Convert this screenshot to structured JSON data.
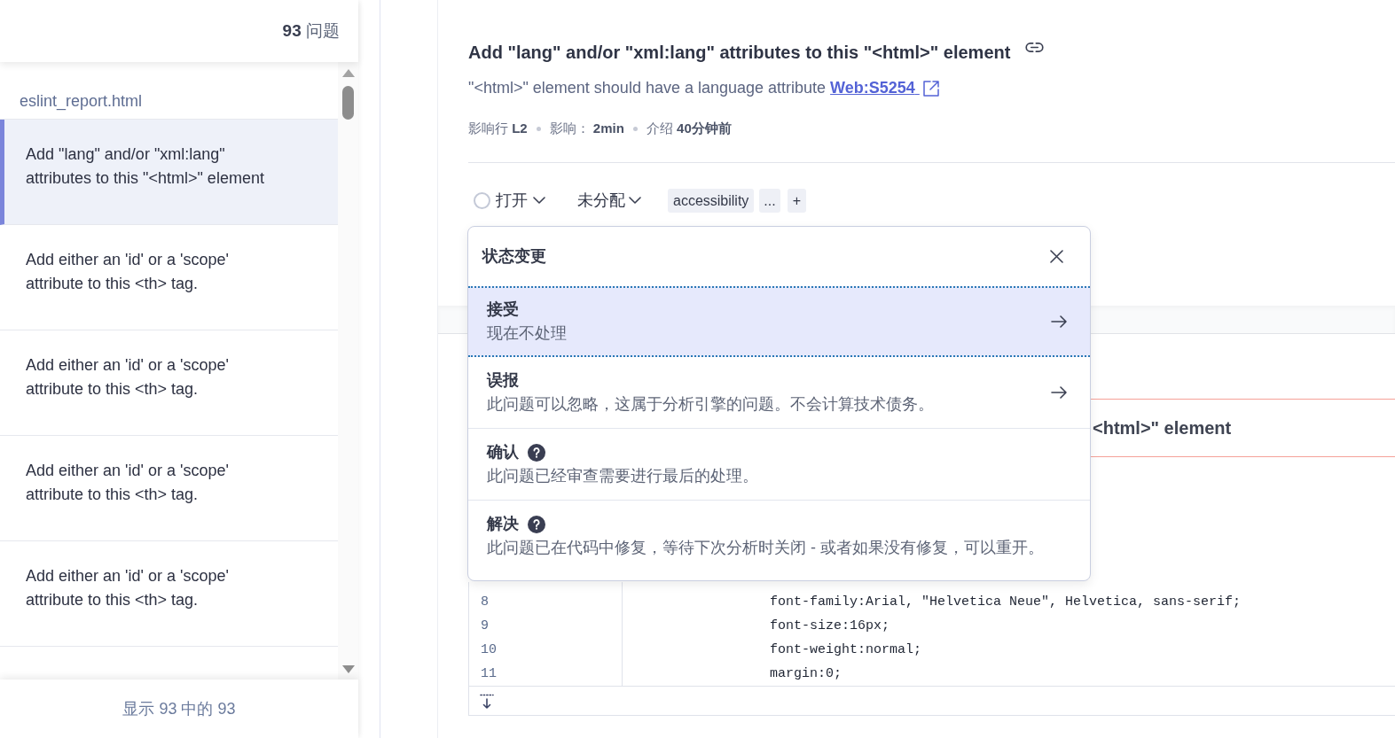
{
  "sidebar": {
    "issue_count": "**93** 问题",
    "file": "eslint_report.html",
    "issues": [
      {
        "text": "Add \"lang\" and/or \"xml:lang\" attributes to this \"<html>\" element",
        "selected": true
      },
      {
        "text": "Add either an 'id' or a 'scope' attribute to this <th> tag.",
        "selected": false
      },
      {
        "text": "Add either an 'id' or a 'scope' attribute to this <th> tag.",
        "selected": false
      },
      {
        "text": "Add either an 'id' or a 'scope' attribute to this <th> tag.",
        "selected": false
      },
      {
        "text": "Add either an 'id' or a 'scope' attribute to this <th> tag.",
        "selected": false
      }
    ],
    "footer": "显示 93 中的 93"
  },
  "issue": {
    "title": "Add \"lang\" and/or \"xml:lang\" attributes to this \"<html>\" element",
    "description": "\"<html>\" element should have a language attribute",
    "rule_link": "Web:S5254",
    "meta": [
      "影响行 **L2**",
      "影响： **2min**",
      "介绍 **40分钟前**"
    ],
    "status": "打开",
    "assignee": "未分配",
    "tags": [
      "accessibility"
    ],
    "more_tags": "...",
    "add_tag": "+"
  },
  "status_popup": {
    "title": "状态变更",
    "options": [
      {
        "kind": "arrow",
        "label": "接受",
        "description": "现在不处理",
        "selected": true
      },
      {
        "kind": "arrow",
        "label": "误报",
        "description": "此问题可以忽略，这属于分析引擎的问题。不会计算技术债务。",
        "selected": false
      },
      {
        "kind": "help",
        "label": "确认",
        "description": "此问题已经审查需要进行最后的处理。",
        "selected": false
      },
      {
        "kind": "help",
        "label": "解决",
        "description": "此问题已在代码中修复，等待下次分析时关闭 - 或者如果没有修复，可以重开。",
        "selected": false
      }
    ]
  },
  "code_view": {
    "message": "<html>\" element",
    "lines": [
      {
        "number": "8",
        "code": "font-family:Arial, \"Helvetica Neue\", Helvetica, sans-serif;"
      },
      {
        "number": "9",
        "code": "font-size:16px;"
      },
      {
        "number": "10",
        "code": "font-weight:normal;"
      },
      {
        "number": "11",
        "code": "margin:0;"
      }
    ]
  }
}
